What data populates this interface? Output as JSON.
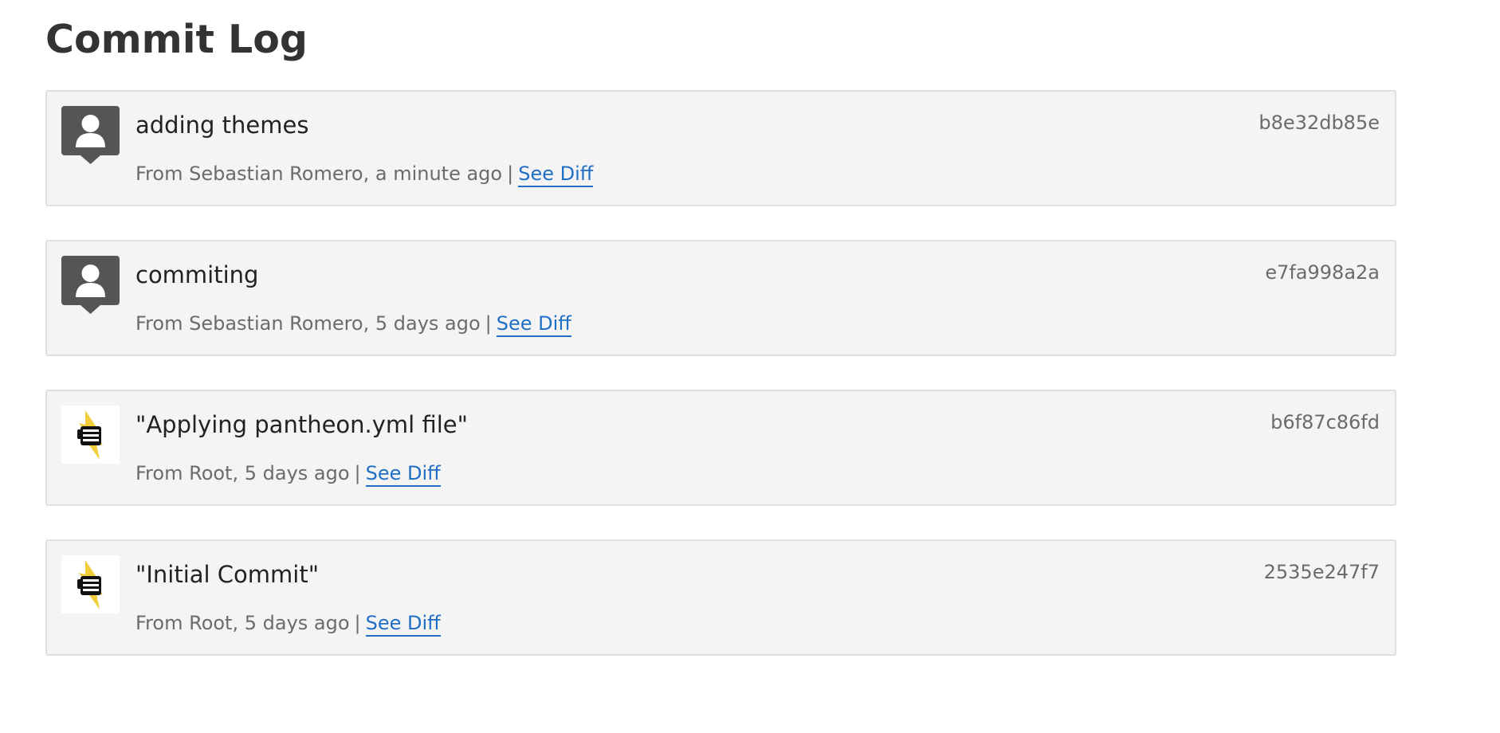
{
  "page": {
    "title": "Commit Log"
  },
  "commits": [
    {
      "message": "adding themes",
      "author": "Sebastian Romero",
      "time": "a minute ago",
      "from_text": "From Sebastian Romero, a minute ago",
      "separator": "|",
      "diff_label": "See Diff",
      "hash": "b8e32db85e",
      "avatar": "person-icon"
    },
    {
      "message": "commiting",
      "author": "Sebastian Romero",
      "time": "5 days ago",
      "from_text": "From Sebastian Romero, 5 days ago",
      "separator": "|",
      "diff_label": "See Diff",
      "hash": "e7fa998a2a",
      "avatar": "person-icon"
    },
    {
      "message": "\"Applying pantheon.yml file\"",
      "author": "Root",
      "time": "5 days ago",
      "from_text": "From Root, 5 days ago",
      "separator": "|",
      "diff_label": "See Diff",
      "hash": "b6f87c86fd",
      "avatar": "pantheon-fist-logo-icon"
    },
    {
      "message": "\"Initial Commit\"",
      "author": "Root",
      "time": "5 days ago",
      "from_text": "From Root, 5 days ago",
      "separator": "|",
      "diff_label": "See Diff",
      "hash": "2535e247f7",
      "avatar": "pantheon-fist-logo-icon"
    }
  ],
  "colors": {
    "link": "#1f6fc5",
    "card_bg": "#f4f4f4",
    "card_border": "#e0e0e0",
    "avatar_bg": "#555555",
    "bolt": "#f2cd3a"
  }
}
